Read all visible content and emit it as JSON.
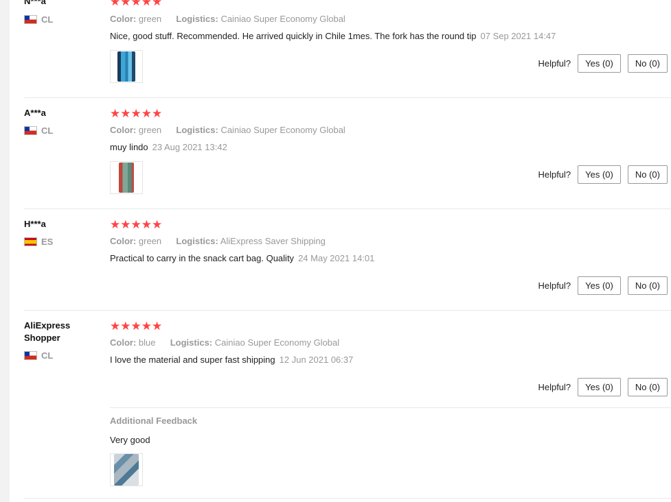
{
  "reviews": [
    {
      "user": "N***a",
      "country": "CL",
      "stars": "★★★★★",
      "color_label": "Color:",
      "color": "green",
      "logistics_label": "Logistics:",
      "logistics": "Cainiao Super Economy Global",
      "text": "Nice, good stuff. Recommended. He arrived quickly in Chile 1mes. The fork has the round tip",
      "date": "07 Sep 2021 14:47",
      "helpful_label": "Helpful?",
      "yes_label": "Yes (0)",
      "no_label": "No (0)"
    },
    {
      "user": "A***a",
      "country": "CL",
      "stars": "★★★★★",
      "color_label": "Color:",
      "color": "green",
      "logistics_label": "Logistics:",
      "logistics": "Cainiao Super Economy Global",
      "text": "muy lindo",
      "date": "23 Aug 2021 13:42",
      "helpful_label": "Helpful?",
      "yes_label": "Yes (0)",
      "no_label": "No (0)"
    },
    {
      "user": "H***a",
      "country": "ES",
      "stars": "★★★★★",
      "color_label": "Color:",
      "color": "green",
      "logistics_label": "Logistics:",
      "logistics": "AliExpress Saver Shipping",
      "text": "Practical to carry in the snack cart bag. Quality",
      "date": "24 May 2021 14:01",
      "helpful_label": "Helpful?",
      "yes_label": "Yes (0)",
      "no_label": "No (0)"
    },
    {
      "user": "AliExpress Shopper",
      "country": "CL",
      "stars": "★★★★★",
      "color_label": "Color:",
      "color": "blue",
      "logistics_label": "Logistics:",
      "logistics": "Cainiao Super Economy Global",
      "text": "I love the material and super fast shipping",
      "date": "12 Jun 2021 06:37",
      "helpful_label": "Helpful?",
      "yes_label": "Yes (0)",
      "no_label": "No (0)",
      "additional_title": "Additional Feedback",
      "additional_text": "Very good"
    }
  ]
}
